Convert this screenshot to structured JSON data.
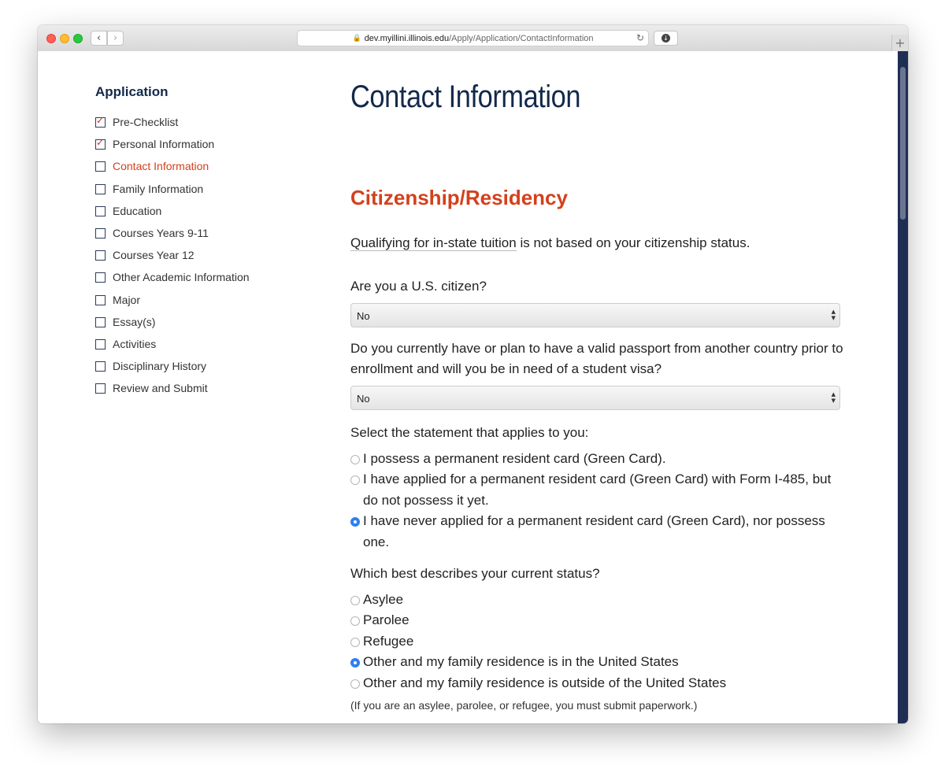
{
  "browser": {
    "url_host": "dev.myillini.illinois.edu",
    "url_path": "/Apply/Application/ContactInformation"
  },
  "sidebar": {
    "title": "Application",
    "items": [
      {
        "label": "Pre-Checklist",
        "checked": true,
        "current": false
      },
      {
        "label": "Personal Information",
        "checked": true,
        "current": false
      },
      {
        "label": "Contact Information",
        "checked": false,
        "current": true
      },
      {
        "label": "Family Information",
        "checked": false,
        "current": false
      },
      {
        "label": "Education",
        "checked": false,
        "current": false
      },
      {
        "label": "Courses Years 9-11",
        "checked": false,
        "current": false
      },
      {
        "label": "Courses Year 12",
        "checked": false,
        "current": false
      },
      {
        "label": "Other Academic Information",
        "checked": false,
        "current": false
      },
      {
        "label": "Major",
        "checked": false,
        "current": false
      },
      {
        "label": "Essay(s)",
        "checked": false,
        "current": false
      },
      {
        "label": "Activities",
        "checked": false,
        "current": false
      },
      {
        "label": "Disciplinary History",
        "checked": false,
        "current": false
      },
      {
        "label": "Review and Submit",
        "checked": false,
        "current": false
      }
    ]
  },
  "main": {
    "page_title": "Contact Information",
    "section_title": "Citizenship/Residency",
    "intro_link": "Qualifying for in-state tuition",
    "intro_rest": " is not based on your citizenship status.",
    "q_citizen": "Are you a U.S. citizen?",
    "citizen_value": "No",
    "q_passport": "Do you currently have or plan to have a valid passport from another country prior to enrollment and will you be in need of a student visa?",
    "passport_value": "No",
    "q_statement": "Select the statement that applies to you:",
    "statements": [
      {
        "label": "I possess a permanent resident card (Green Card).",
        "selected": false
      },
      {
        "label": "I have applied for a permanent resident card (Green Card) with Form I-485, but do not possess it yet.",
        "selected": false
      },
      {
        "label": "I have never applied for a permanent resident card (Green Card), nor possess one.",
        "selected": true
      }
    ],
    "q_status": "Which best describes your current status?",
    "statuses": [
      {
        "label": "Asylee",
        "selected": false
      },
      {
        "label": "Parolee",
        "selected": false
      },
      {
        "label": "Refugee",
        "selected": false
      },
      {
        "label": "Other and my family residence is in the United States",
        "selected": true
      },
      {
        "label": "Other and my family residence is outside of the United States",
        "selected": false
      }
    ],
    "note": "(If you are an asylee, parolee, or refugee, you must submit paperwork.)"
  },
  "colors": {
    "navy": "#13294b",
    "orange": "#d4401c",
    "radio_selected": "#2f7ff2"
  }
}
